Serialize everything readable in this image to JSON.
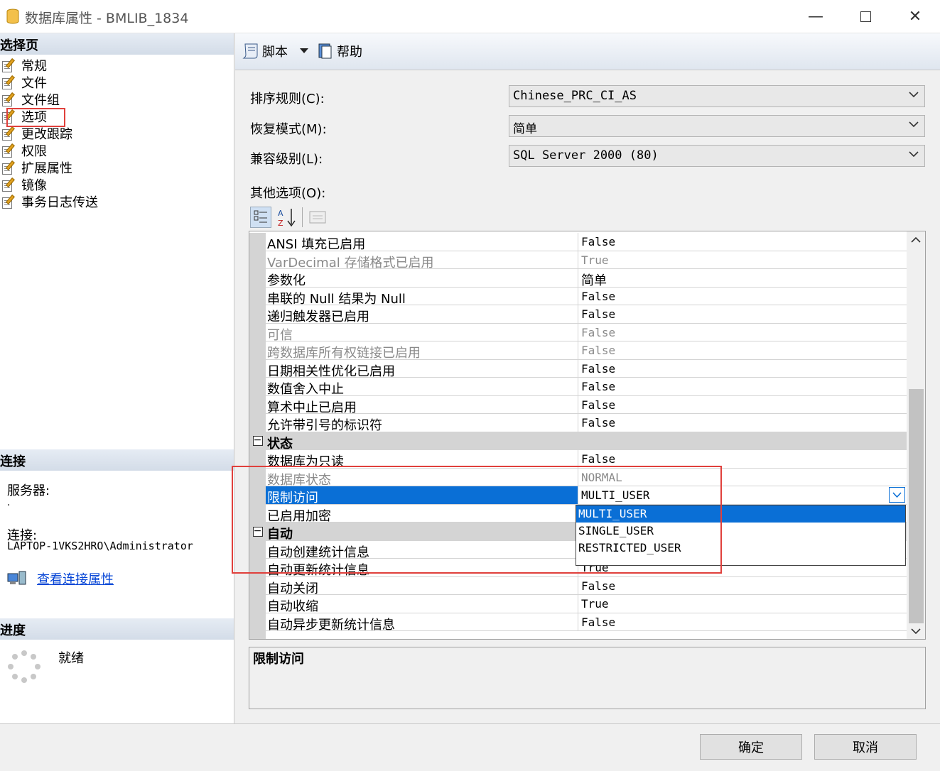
{
  "window": {
    "title": "数据库属性 - BMLIB_1834"
  },
  "left": {
    "select_page_header": "选择页",
    "pages": [
      {
        "label": "常规"
      },
      {
        "label": "文件"
      },
      {
        "label": "文件组"
      },
      {
        "label": "选项"
      },
      {
        "label": "更改跟踪"
      },
      {
        "label": "权限"
      },
      {
        "label": "扩展属性"
      },
      {
        "label": "镜像"
      },
      {
        "label": "事务日志传送"
      }
    ],
    "connection_header": "连接",
    "server_label": "服务器:",
    "server_value": ".",
    "connection_label": "连接:",
    "connection_value": "LAPTOP-1VKS2HRO\\Administrator",
    "view_connection_link": "查看连接属性",
    "progress_header": "进度",
    "progress_status": "就绪"
  },
  "toolbar": {
    "script_label": "脚本",
    "help_label": "帮助"
  },
  "form": {
    "collation_label": "排序规则(C):",
    "collation_value": "Chinese_PRC_CI_AS",
    "recovery_label": "恢复模式(M):",
    "recovery_value": "简单",
    "compat_label": "兼容级别(L):",
    "compat_value": "SQL Server 2000 (80)",
    "other_options_label": "其他选项(O):"
  },
  "grid": {
    "rows": [
      {
        "name": "ANSI 填充已启用",
        "value": "False"
      },
      {
        "name": "VarDecimal 存储格式已启用",
        "value": "True"
      },
      {
        "name": "参数化",
        "value": "简单"
      },
      {
        "name": "串联的 Null 结果为 Null",
        "value": "False"
      },
      {
        "name": "递归触发器已启用",
        "value": "False"
      },
      {
        "name": "可信",
        "value": "False"
      },
      {
        "name": "跨数据库所有权链接已启用",
        "value": "False"
      },
      {
        "name": "日期相关性优化已启用",
        "value": "False"
      },
      {
        "name": "数值舍入中止",
        "value": "False"
      },
      {
        "name": "算术中止已启用",
        "value": "False"
      },
      {
        "name": "允许带引号的标识符",
        "value": "False"
      },
      {
        "name": "状态",
        "value": ""
      },
      {
        "name": "数据库为只读",
        "value": "False"
      },
      {
        "name": "数据库状态",
        "value": "NORMAL"
      },
      {
        "name": "限制访问",
        "value": "MULTI_USER"
      },
      {
        "name": "已启用加密",
        "value": ""
      },
      {
        "name": "自动",
        "value": ""
      },
      {
        "name": "自动创建统计信息",
        "value": ""
      },
      {
        "name": "自动更新统计信息",
        "value": "True"
      },
      {
        "name": "自动关闭",
        "value": "False"
      },
      {
        "name": "自动收缩",
        "value": "True"
      },
      {
        "name": "自动异步更新统计信息",
        "value": "False"
      }
    ],
    "dropdown_options": [
      "MULTI_USER",
      "SINGLE_USER",
      "RESTRICTED_USER"
    ]
  },
  "description": {
    "title": "限制访问"
  },
  "buttons": {
    "ok": "确定",
    "cancel": "取消"
  }
}
